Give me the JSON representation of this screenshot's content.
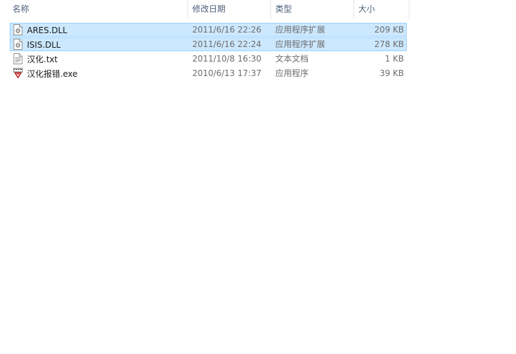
{
  "columns": {
    "name": "名称",
    "date": "修改日期",
    "type": "类型",
    "size": "大小"
  },
  "sort_indicator": "^",
  "files": [
    {
      "name": "ARES.DLL",
      "date": "2011/6/16 22:26",
      "type": "应用程序扩展",
      "size": "209 KB",
      "icon": "dll-file-icon",
      "selected": true
    },
    {
      "name": "ISIS.DLL",
      "date": "2011/6/16 22:24",
      "type": "应用程序扩展",
      "size": "278 KB",
      "icon": "dll-file-icon",
      "selected": true
    },
    {
      "name": "汉化.txt",
      "date": "2011/10/8 16:30",
      "type": "文本文档",
      "size": "1 KB",
      "icon": "text-file-icon",
      "selected": false
    },
    {
      "name": "汉化报错.exe",
      "date": "2010/6/13 17:37",
      "type": "应用程序",
      "size": "39 KB",
      "icon": "exe-app-icon",
      "selected": false
    }
  ],
  "colors": {
    "selection_bg": "#cce8ff",
    "selection_border": "#99d1ff",
    "header_text": "#4c607a"
  }
}
